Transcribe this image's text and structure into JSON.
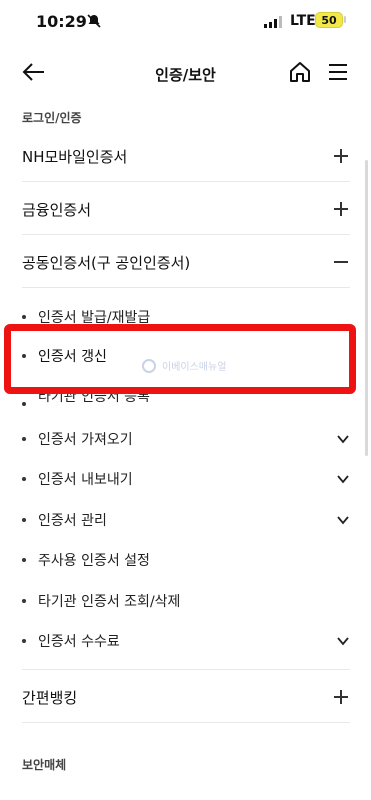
{
  "status_bar": {
    "time": "10:29",
    "network": "LTE",
    "battery": "50"
  },
  "header": {
    "title": "인증/보안"
  },
  "sections": {
    "login_auth": "로그인/인증",
    "security_media": "보안매체"
  },
  "rows": {
    "nh_mobile": "NH모바일인증서",
    "financial": "금융인증서",
    "joint": "공동인증서(구 공인인증서)",
    "simple_banking": "간편뱅킹"
  },
  "sub_items": {
    "issue": "인증서 발급/재발급",
    "renew": "인증서 갱신",
    "register_other": "타기관 인증서 등록",
    "import": "인증서 가져오기",
    "export": "인증서 내보내기",
    "manage": "인증서 관리",
    "personal_setting": "주사용 인증서 설정",
    "other_view_delete": "타기관 인증서 조회/삭제",
    "fee": "인증서 수수료"
  },
  "watermark": "이베이스매뉴얼",
  "colors": {
    "highlight": "#ee1313",
    "battery": "#f3e84a"
  },
  "icons": [
    "back-arrow-icon",
    "home-icon",
    "menu-icon",
    "plus-icon",
    "minus-icon",
    "chevron-down-icon"
  ]
}
